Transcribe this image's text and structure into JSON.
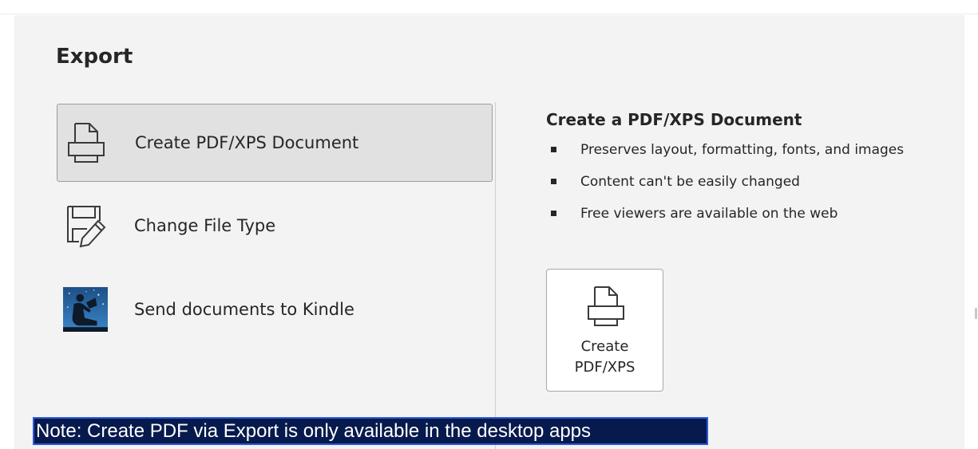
{
  "section_title": "Export",
  "options": [
    {
      "label": "Create PDF/XPS Document",
      "icon": "pdf-document-icon",
      "selected": true
    },
    {
      "label": "Change File Type",
      "icon": "change-file-type-icon",
      "selected": false
    },
    {
      "label": "Send documents to Kindle",
      "icon": "kindle-icon",
      "selected": false
    }
  ],
  "detail": {
    "title": "Create a PDF/XPS Document",
    "bullets": [
      "Preserves layout, formatting, fonts, and images",
      "Content can't be easily changed",
      "Free viewers are available on the web"
    ],
    "button_line1": "Create",
    "button_line2": "PDF/XPS"
  },
  "note": "Note: Create PDF via Export is only available in the desktop apps",
  "colors": {
    "panel_bg": "#f3f3f3",
    "selected_bg": "#e1e1e1",
    "note_bg": "#061a4d",
    "note_border": "#2a58d9"
  }
}
